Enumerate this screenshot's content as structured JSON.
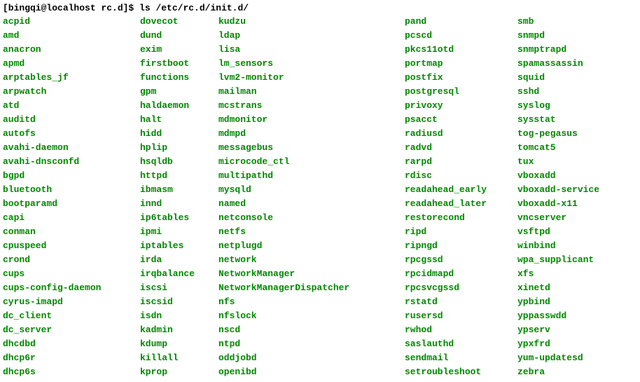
{
  "prompt": {
    "full": "[bingqi@localhost rc.d]$ ",
    "command": "ls /etc/rc.d/init.d/"
  },
  "columns": [
    [
      "acpid",
      "amd",
      "anacron",
      "apmd",
      "arptables_jf",
      "arpwatch",
      "atd",
      "auditd",
      "autofs",
      "avahi-daemon",
      "avahi-dnsconfd",
      "bgpd",
      "bluetooth",
      "bootparamd",
      "capi",
      "conman",
      "cpuspeed",
      "crond",
      "cups",
      "cups-config-daemon",
      "cyrus-imapd",
      "dc_client",
      "dc_server",
      "dhcdbd",
      "dhcp6r",
      "dhcp6s"
    ],
    [
      "dovecot",
      "dund",
      "exim",
      "firstboot",
      "functions",
      "gpm",
      "haldaemon",
      "halt",
      "hidd",
      "hplip",
      "hsqldb",
      "httpd",
      "ibmasm",
      "innd",
      "ip6tables",
      "ipmi",
      "iptables",
      "irda",
      "irqbalance",
      "iscsi",
      "iscsid",
      "isdn",
      "kadmin",
      "kdump",
      "killall",
      "kprop"
    ],
    [
      "kudzu",
      "ldap",
      "lisa",
      "lm_sensors",
      "lvm2-monitor",
      "mailman",
      "mcstrans",
      "mdmonitor",
      "mdmpd",
      "messagebus",
      "microcode_ctl",
      "multipathd",
      "mysqld",
      "named",
      "netconsole",
      "netfs",
      "netplugd",
      "network",
      "NetworkManager",
      "NetworkManagerDispatcher",
      "nfs",
      "nfslock",
      "nscd",
      "ntpd",
      "oddjobd",
      "openibd"
    ],
    [
      "pand",
      "pcscd",
      "pkcs11otd",
      "portmap",
      "postfix",
      "postgresql",
      "privoxy",
      "psacct",
      "radiusd",
      "radvd",
      "rarpd",
      "rdisc",
      "readahead_early",
      "readahead_later",
      "restorecond",
      "ripd",
      "ripngd",
      "rpcgssd",
      "rpcidmapd",
      "rpcsvcgssd",
      "rstatd",
      "rusersd",
      "rwhod",
      "saslauthd",
      "sendmail",
      "setroubleshoot"
    ],
    [
      "smb",
      "snmpd",
      "snmptrapd",
      "spamassassin",
      "squid",
      "sshd",
      "syslog",
      "sysstat",
      "tog-pegasus",
      "tomcat5",
      "tux",
      "vboxadd",
      "vboxadd-service",
      "vboxadd-x11",
      "vncserver",
      "vsftpd",
      "winbind",
      "wpa_supplicant",
      "xfs",
      "xinetd",
      "ypbind",
      "yppasswdd",
      "ypserv",
      "ypxfrd",
      "yum-updatesd",
      "zebra"
    ]
  ]
}
